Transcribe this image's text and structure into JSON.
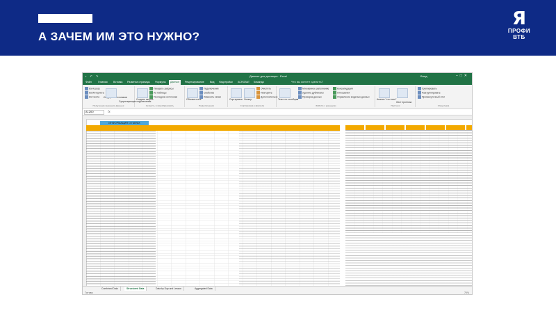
{
  "slide": {
    "title": "А ЗАЧЕМ ИМ ЭТО НУЖНО?",
    "logo": {
      "mark": "Я",
      "line1": "ПРОФИ",
      "line2": "ВТБ"
    },
    "colors": {
      "header": "#0e2a86",
      "excel_green": "#217346",
      "table_header": "#f2a900",
      "info_title_fill": "#4fa7d9"
    }
  },
  "excel": {
    "title": "Данные для договора - Excel",
    "user": "Влад",
    "tabs": [
      "Файл",
      "Главная",
      "Вставка",
      "Разметка страницы",
      "Формулы",
      "Данные",
      "Рецензирование",
      "Вид",
      "Надстройки",
      "ACROBAT",
      "Команда"
    ],
    "active_tab": "Данные",
    "tell_me": "Что вы хотите сделать?",
    "ribbon_groups": [
      {
        "caption": "Получение внешних данных",
        "buttons": [
          "Из Access",
          "Из Интернета",
          "Из текста",
          "Из других источников",
          "Существующие подключения"
        ]
      },
      {
        "caption": "Скачать и преобразовать",
        "buttons": [
          "Создать запрос",
          "Показать запросы",
          "Из таблицы",
          "Последние источники"
        ]
      },
      {
        "caption": "Подключения",
        "buttons": [
          "Обновить все",
          "Подключения",
          "Свойства",
          "Изменить связи"
        ]
      },
      {
        "caption": "Сортировка и фильтр",
        "buttons": [
          "Сортировка",
          "Фильтр",
          "Очистить",
          "Повторить",
          "Дополнительно"
        ]
      },
      {
        "caption": "Работа с данными",
        "buttons": [
          "Текст по столбцам",
          "Мгновенное заполнение",
          "Удалить дубликаты",
          "Проверка данных",
          "Консолидация",
          "Отношения",
          "Управление моделью данных"
        ]
      },
      {
        "caption": "Прогноз",
        "buttons": [
          "Анализ \"что если\"",
          "Лист прогноза"
        ]
      },
      {
        "caption": "Структура",
        "buttons": [
          "Группировать",
          "Разгруппировать",
          "Промежуточный итог"
        ]
      }
    ],
    "name_box": "A1200",
    "fx_label": "fx",
    "info_title": "ИНФОРМАЦИЯ О ПАРАХ",
    "sheets": [
      "Combined Data",
      "Structured Data",
      "Data by Day and Lesson",
      "Aggregated Data"
    ],
    "active_sheet": "Structured Data",
    "status": "Готово",
    "zoom": "70%"
  }
}
